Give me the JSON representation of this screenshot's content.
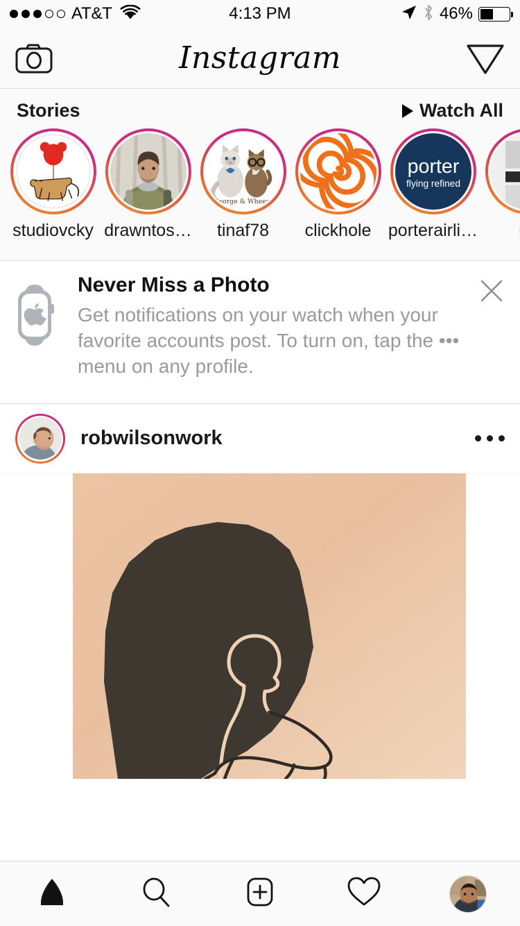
{
  "status_bar": {
    "signal_dots_filled": 3,
    "signal_dots_total": 5,
    "carrier": "AT&T",
    "wifi_icon": "wifi-icon",
    "time": "4:13 PM",
    "location_icon": "location-arrow-icon",
    "bluetooth_icon": "bluetooth-icon",
    "battery_percent": "46%",
    "battery_level": 46
  },
  "nav_bar": {
    "camera_icon": "camera-icon",
    "title": "Instagram",
    "direct_icon": "paper-plane-icon"
  },
  "stories": {
    "title": "Stories",
    "watch_all_label": "Watch All",
    "play_icon": "play-triangle-icon",
    "items": [
      {
        "username": "studiovcky",
        "avatar": "cat-with-red-balloon-illustration",
        "has_unseen": true
      },
      {
        "username": "drawntos…",
        "avatar": "man-with-backpack-in-snow-photo",
        "has_unseen": true
      },
      {
        "username": "tinaf78",
        "avatar": "two-cats-george-and-wheezy-illustration",
        "has_unseen": true
      },
      {
        "username": "clickhole",
        "avatar": "orange-spiral-logo",
        "has_unseen": true
      },
      {
        "username": "porterairli…",
        "avatar": "porter-flying-refined-logo",
        "has_unseen": true
      },
      {
        "username": "us",
        "avatar": "partial-cutoff-avatar",
        "has_unseen": true
      }
    ],
    "avatar_text": {
      "tinaf78_caption": "George & Wheezy",
      "porter_line1": "porter",
      "porter_line2": "flying refined"
    }
  },
  "banner": {
    "icon": "apple-watch-icon",
    "title": "Never Miss a Photo",
    "body": "Get notifications on your watch when your favorite accounts post. To turn on, tap the ••• menu on any profile.",
    "close_icon": "close-x-icon"
  },
  "post": {
    "username": "robwilsonwork",
    "avatar": "mans-profile-portrait-photo",
    "has_story_ring": true,
    "more_icon": "more-options-dots-icon",
    "image_description": "line-drawing-of-seated-figure-with-large-dark-shape-on-peach-paper"
  },
  "tab_bar": {
    "items": [
      {
        "name": "home",
        "icon": "home-icon",
        "active": true
      },
      {
        "name": "search",
        "icon": "search-magnifier-icon",
        "active": false
      },
      {
        "name": "add-post",
        "icon": "plus-square-icon",
        "active": false
      },
      {
        "name": "activity",
        "icon": "heart-icon",
        "active": false
      },
      {
        "name": "profile",
        "icon": "profile-avatar-icon",
        "active": false
      }
    ]
  },
  "colors": {
    "ring_gradient_start": "#c13584",
    "ring_gradient_end": "#f09433",
    "background": "#fafafa",
    "border": "#dbdbdb",
    "text_primary": "#1a1a1a",
    "text_muted": "#9a9a9a",
    "post_image_bg": "#e7bf9e",
    "post_image_ink": "#3a342c",
    "porter_navy": "#16365c",
    "clickhole_orange": "#f07019"
  }
}
